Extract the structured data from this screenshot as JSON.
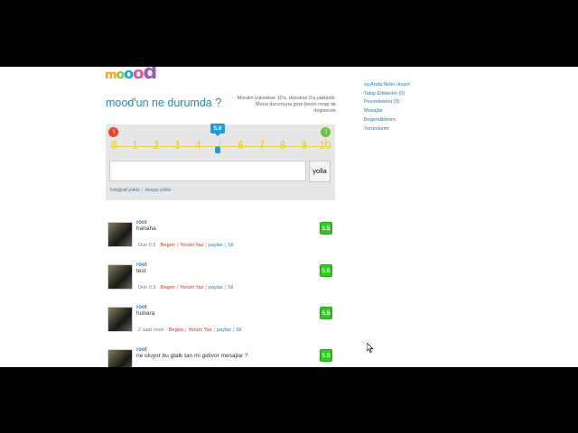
{
  "brand": {
    "logo_letters": [
      "m",
      "o",
      "o",
      "o",
      "d"
    ],
    "logo_colors": [
      "#f5a623",
      "#7ac943",
      "#1a9fdb",
      "#e94f9a",
      "#9b59b6"
    ]
  },
  "composer": {
    "headline": "mood'un ne durumda ?",
    "hint": "Moralin yuksekse 10'a, dusukse 0'a yaklastir. Moral durumuna gore benin rengi de degisecek",
    "scale_numbers": [
      "0",
      "1",
      "2",
      "3",
      "4",
      "5",
      "6",
      "7",
      "8",
      "9",
      "10"
    ],
    "current_value": 5.0,
    "current_value_label": "5.0",
    "input_value": "",
    "input_placeholder": "",
    "submit_label": "yolla",
    "photo_link": "fotoğraf yükle",
    "file_link": "dosya yükle",
    "sad_face": ":(",
    "happy_face": ":)"
  },
  "sidebar": {
    "items": [
      {
        "label": "su Anda Neler oluyor"
      },
      {
        "label": "Takip Ettiklerim (0)"
      },
      {
        "label": "Pesimdekiler (0)"
      },
      {
        "label": "Mesajlar"
      },
      {
        "label": "Begendiklerim"
      },
      {
        "label": "Yorumlarim"
      }
    ]
  },
  "feed": {
    "posts": [
      {
        "user": "root",
        "text": "hahaha",
        "score": "5.5",
        "time": "Dun 0:3",
        "like": "Begen",
        "reply": "Yorum Yaz",
        "share": "paylas",
        "delete": "Sil"
      },
      {
        "user": "root",
        "text": "test",
        "score": "5.5",
        "time": "Dun 0:3",
        "like": "Begen",
        "reply": "Yorum Yaz",
        "share": "paylas",
        "delete": "Sil"
      },
      {
        "user": "root",
        "text": "hubara",
        "score": "5.5",
        "time": "2 saat once",
        "like": "Begen",
        "reply": "Yorum Yaz",
        "share": "paylas",
        "delete": "Sil"
      },
      {
        "user": "root",
        "text": "ne oluyor bu gtalk tan mi gidivor mesajlar ?",
        "score": "5.5",
        "time": "",
        "like": "",
        "reply": "",
        "share": "",
        "delete": ""
      }
    ]
  },
  "colors": {
    "accent": "#1a9fdb",
    "scale": "#e6cd2e",
    "score": "#2ecc1f"
  }
}
